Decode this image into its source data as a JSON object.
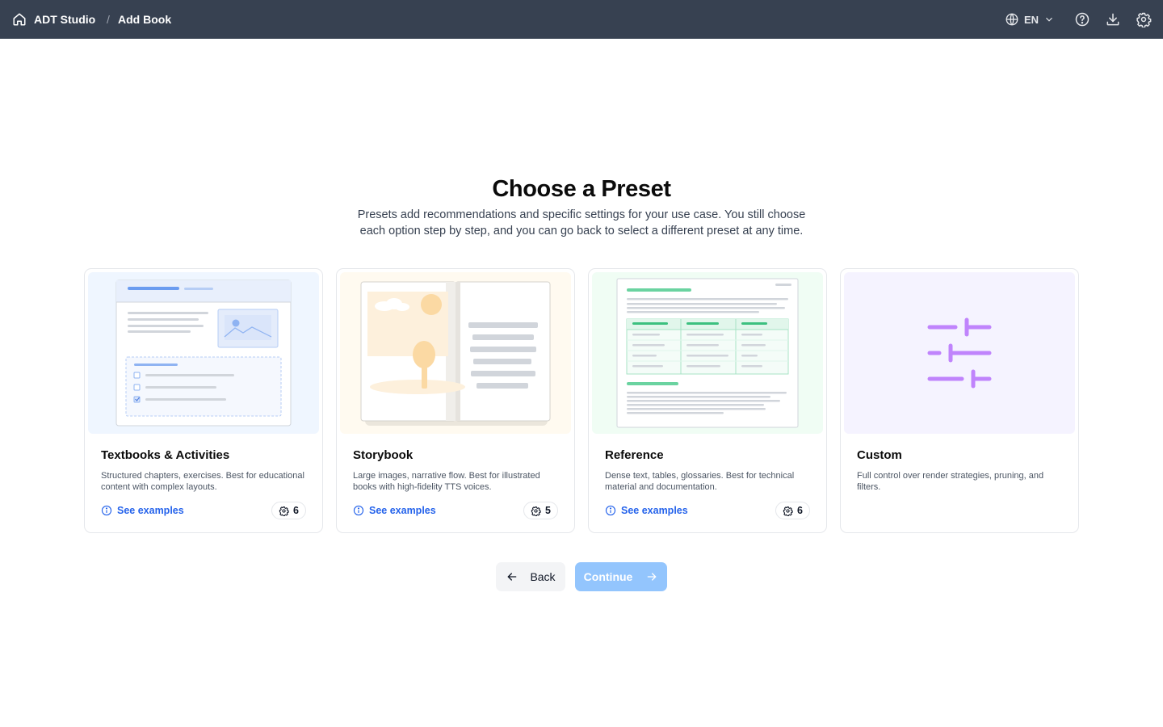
{
  "header": {
    "breadcrumb_app": "ADT Studio",
    "breadcrumb_separator": "/",
    "breadcrumb_page": "Add Book",
    "language": "EN",
    "icons": [
      "home-icon",
      "globe-icon",
      "chevron-down-icon",
      "help-icon",
      "download-icon",
      "settings-icon"
    ]
  },
  "main": {
    "title": "Choose a Preset",
    "subtitle": "Presets add recommendations and specific settings for your use case. You still choose each option step by step, and you can go back to select a different preset at any time."
  },
  "presets": [
    {
      "title": "Textbooks & Activities",
      "description": "Structured chapters, exercises. Best for educational content with complex layouts.",
      "link": "See examples",
      "settings_count": "6",
      "accent": "#eff6ff"
    },
    {
      "title": "Storybook",
      "description": "Large images, narrative flow. Best for illustrated books with high-fidelity TTS voices.",
      "link": "See examples",
      "settings_count": "5",
      "accent": "#fffaf0"
    },
    {
      "title": "Reference",
      "description": "Dense text, tables, glossaries. Best for technical material and documentation.",
      "link": "See examples",
      "settings_count": "6",
      "accent": "#f0fdf4"
    },
    {
      "title": "Custom",
      "description": "Full control over render strategies, pruning, and filters.",
      "accent": "#f5f3ff"
    }
  ],
  "actions": {
    "back_label": "Back",
    "continue_label": "Continue"
  },
  "colors": {
    "topbar": "#374151",
    "link": "#2563eb",
    "continue_disabled": "#93c5fd",
    "custom_icon": "#c084fc"
  }
}
